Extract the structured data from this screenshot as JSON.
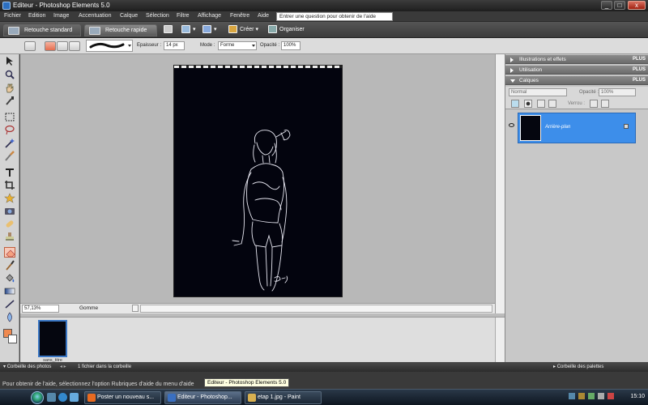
{
  "window": {
    "title": "Editeur - Photoshop Elements 5.0",
    "controls": {
      "minimize": "_",
      "maximize": "□",
      "close": "x"
    }
  },
  "menubar": {
    "items": [
      "Fichier",
      "Edition",
      "Image",
      "Accentuation",
      "Calque",
      "Sélection",
      "Filtre",
      "Affichage",
      "Fenêtre",
      "Aide"
    ],
    "help_placeholder": "Entrer une question pour obtenir de l'aide"
  },
  "modebar": {
    "tab_standard": "Retouche standard",
    "tab_rapide": "Retouche rapide",
    "create_label": "Créer",
    "organize_label": "Organiser"
  },
  "options": {
    "thickness_label": "Epaisseur :",
    "thickness_value": "14 px",
    "mode_label": "Mode :",
    "mode_value": "Forme",
    "opacity_label": "Opacité :",
    "opacity_value": "100%"
  },
  "status": {
    "zoom": "57,13%",
    "tool_name": "Gomme"
  },
  "photobin": {
    "thumb_label": "sans_titre",
    "bar_label": "Corbeille des photos",
    "file_count": "1 fichier dans la corbeille",
    "palettes_label": "Corbeille des palettes"
  },
  "palettes": {
    "illustrations": "Illustrations et effets",
    "utilisation": "Utilisation",
    "calques": "Calques",
    "plus": "PLUS",
    "blend_mode": "Normal",
    "opacity_label": "Opacité :",
    "opacity_value": "100%",
    "lock_label": "Verrou :",
    "layer_name": "Arrière-plan"
  },
  "infobar": {
    "help_text": "Pour obtenir de l'aide, sélectionnez l'option Rubriques d'aide du menu d'aide",
    "tooltip": "Editeur - Photoshop Elements 5.0"
  },
  "taskbar": {
    "tasks": [
      "Poster un nouveau s...",
      "Editeur - Photoshop...",
      "etap 1.jpg - Paint"
    ],
    "clock": "15:10"
  },
  "colors": {
    "foreground": "#f08a50",
    "background": "#ffffff",
    "selected_layer": "#3d8eea"
  }
}
